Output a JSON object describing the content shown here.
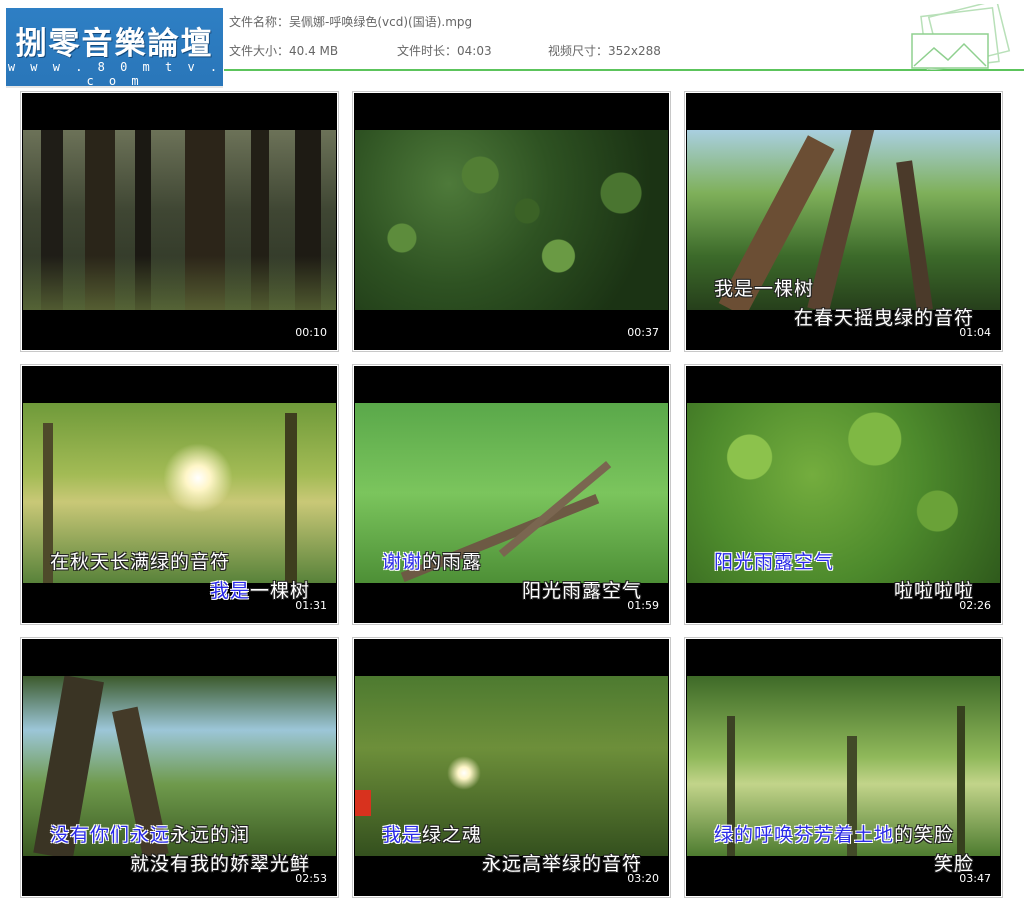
{
  "header": {
    "logo_cn": "捌零音樂論壇",
    "logo_url": "w w w . 8 0 m t v . c o m",
    "file_name_label": "文件名称：",
    "file_name": "吴佩娜-呼唤绿色(vcd)(国语).mpg",
    "file_size_label": "文件大小：",
    "file_size": "40.4 MB",
    "duration_label": "文件时长：",
    "duration": "04:03",
    "dimensions_label": "视频尺寸：",
    "dimensions": "352x288"
  },
  "thumbnails": [
    {
      "time": "00:10",
      "line1_hl": "",
      "line1": "",
      "line2_hl": "",
      "line2": ""
    },
    {
      "time": "00:37",
      "line1_hl": "",
      "line1": "",
      "line2_hl": "",
      "line2": ""
    },
    {
      "time": "01:04",
      "line1_hl": "",
      "line1": "我是一棵树",
      "line2_hl": "",
      "line2": "在春天摇曳绿的音符"
    },
    {
      "time": "01:31",
      "line1_hl": "",
      "line1": "在秋天长满绿的音符",
      "line2_hl": "我是",
      "line2": "一棵树"
    },
    {
      "time": "01:59",
      "line1_hl": "谢谢",
      "line1": "的雨露",
      "line2_hl": "",
      "line2": "阳光雨露空气"
    },
    {
      "time": "02:26",
      "line1_hl": "阳光雨露空气",
      "line1": "",
      "line2_hl": "",
      "line2": "啦啦啦啦"
    },
    {
      "time": "02:53",
      "line1_hl": "没有你们永远",
      "line1": "永远的润",
      "line2_hl": "",
      "line2": "就没有我的娇翠光鲜"
    },
    {
      "time": "03:20",
      "line1_hl": "我是",
      "line1": "绿之魂",
      "line2_hl": "",
      "line2": "永远高举绿的音符"
    },
    {
      "time": "03:47",
      "line1_hl": "绿的呼唤芬芳着土地",
      "line1": "的笑脸",
      "line2_hl": "",
      "line2": "笑脸"
    }
  ]
}
